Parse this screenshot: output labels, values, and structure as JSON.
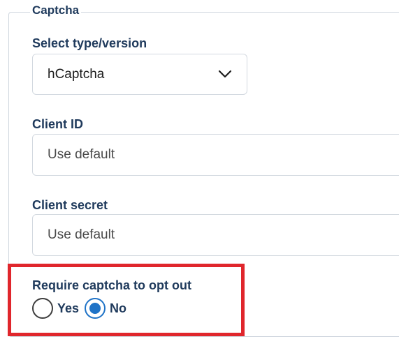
{
  "fieldset": {
    "legend": "Captcha"
  },
  "captcha_type": {
    "label": "Select type/version",
    "selected": "hCaptcha"
  },
  "client_id": {
    "label": "Client ID",
    "placeholder": "Use default"
  },
  "client_secret": {
    "label": "Client secret",
    "placeholder": "Use default"
  },
  "opt_out": {
    "label": "Require captcha to opt out",
    "options": [
      {
        "label": "Yes",
        "checked": false
      },
      {
        "label": "No",
        "checked": true
      }
    ]
  },
  "colors": {
    "highlight": "#e0262c",
    "accent": "#1f73c7",
    "label_text": "#1f3a5c"
  },
  "icons": {
    "select_chevron": "chevron-down-icon"
  }
}
